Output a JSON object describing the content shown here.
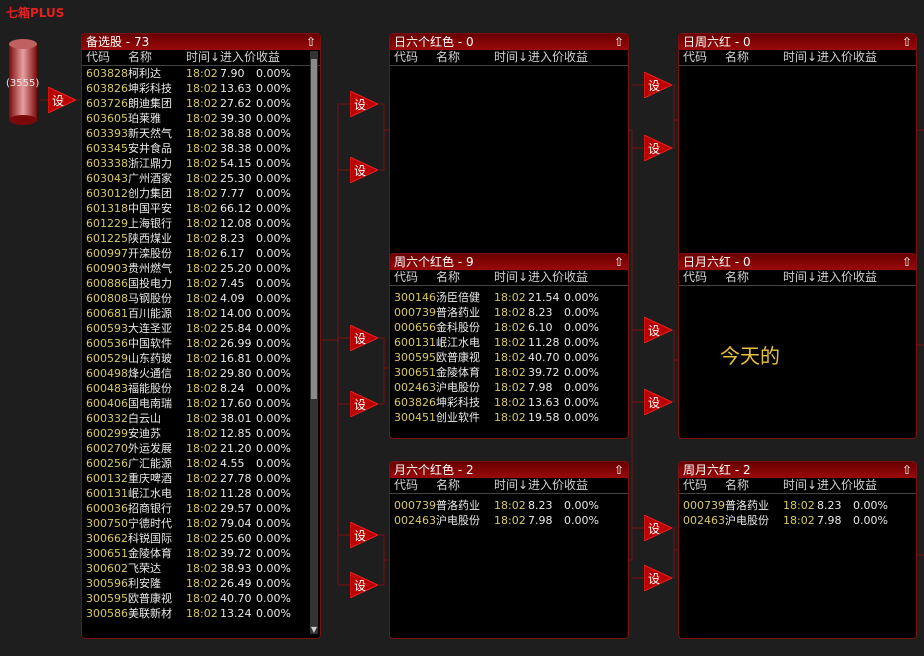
{
  "app_title": "七箱PLUS",
  "source": {
    "count": "(3555)"
  },
  "trigger_label": "设",
  "columns": {
    "code": "代码",
    "name": "名称",
    "time": "时间↓",
    "price": "进入价",
    "pct": "收益"
  },
  "note": "今天的",
  "panels": {
    "main": {
      "title": "备选股 - 73",
      "rows": [
        [
          "603828",
          "柯利达",
          "18:02",
          "7.90",
          "0.00%"
        ],
        [
          "603826",
          "坤彩科技",
          "18:02",
          "13.63",
          "0.00%"
        ],
        [
          "603726",
          "朗迪集团",
          "18:02",
          "27.62",
          "0.00%"
        ],
        [
          "603605",
          "珀莱雅",
          "18:02",
          "39.30",
          "0.00%"
        ],
        [
          "603393",
          "新天然气",
          "18:02",
          "38.88",
          "0.00%"
        ],
        [
          "603345",
          "安井食品",
          "18:02",
          "38.38",
          "0.00%"
        ],
        [
          "603338",
          "浙江鼎力",
          "18:02",
          "54.15",
          "0.00%"
        ],
        [
          "603043",
          "广州酒家",
          "18:02",
          "25.30",
          "0.00%"
        ],
        [
          "603012",
          "创力集团",
          "18:02",
          "7.77",
          "0.00%"
        ],
        [
          "601318",
          "中国平安",
          "18:02",
          "66.12",
          "0.00%"
        ],
        [
          "601229",
          "上海银行",
          "18:02",
          "12.08",
          "0.00%"
        ],
        [
          "601225",
          "陕西煤业",
          "18:02",
          "8.23",
          "0.00%"
        ],
        [
          "600997",
          "开滦股份",
          "18:02",
          "6.17",
          "0.00%"
        ],
        [
          "600903",
          "贵州燃气",
          "18:02",
          "25.20",
          "0.00%"
        ],
        [
          "600886",
          "国投电力",
          "18:02",
          "7.45",
          "0.00%"
        ],
        [
          "600808",
          "马钢股份",
          "18:02",
          "4.09",
          "0.00%"
        ],
        [
          "600681",
          "百川能源",
          "18:02",
          "14.00",
          "0.00%"
        ],
        [
          "600593",
          "大连圣亚",
          "18:02",
          "25.84",
          "0.00%"
        ],
        [
          "600536",
          "中国软件",
          "18:02",
          "26.99",
          "0.00%"
        ],
        [
          "600529",
          "山东药玻",
          "18:02",
          "16.81",
          "0.00%"
        ],
        [
          "600498",
          "烽火通信",
          "18:02",
          "29.80",
          "0.00%"
        ],
        [
          "600483",
          "福能股份",
          "18:02",
          "8.24",
          "0.00%"
        ],
        [
          "600406",
          "国电南瑞",
          "18:02",
          "17.60",
          "0.00%"
        ],
        [
          "600332",
          "白云山",
          "18:02",
          "38.01",
          "0.00%"
        ],
        [
          "600299",
          "安迪苏",
          "18:02",
          "12.85",
          "0.00%"
        ],
        [
          "600270",
          "外运发展",
          "18:02",
          "21.20",
          "0.00%"
        ],
        [
          "600256",
          "广汇能源",
          "18:02",
          "4.55",
          "0.00%"
        ],
        [
          "600132",
          "重庆啤酒",
          "18:02",
          "27.78",
          "0.00%"
        ],
        [
          "600131",
          "岷江水电",
          "18:02",
          "11.28",
          "0.00%"
        ],
        [
          "600036",
          "招商银行",
          "18:02",
          "29.57",
          "0.00%"
        ],
        [
          "300750",
          "宁德时代",
          "18:02",
          "79.04",
          "0.00%"
        ],
        [
          "300662",
          "科锐国际",
          "18:02",
          "25.60",
          "0.00%"
        ],
        [
          "300651",
          "金陵体育",
          "18:02",
          "39.72",
          "0.00%"
        ],
        [
          "300602",
          "飞荣达",
          "18:02",
          "38.93",
          "0.00%"
        ],
        [
          "300596",
          "利安隆",
          "18:02",
          "26.49",
          "0.00%"
        ],
        [
          "300595",
          "欧普康视",
          "18:02",
          "40.70",
          "0.00%"
        ],
        [
          "300586",
          "美联新材",
          "18:02",
          "13.24",
          "0.00%"
        ]
      ]
    },
    "day6": {
      "title": "日六个红色 - 0",
      "rows": []
    },
    "week6": {
      "title": "周六个红色 - 9",
      "rows": [
        [
          "300146",
          "汤臣倍健",
          "18:02",
          "21.54",
          "0.00%"
        ],
        [
          "000739",
          "普洛药业",
          "18:02",
          "8.23",
          "0.00%"
        ],
        [
          "000656",
          "金科股份",
          "18:02",
          "6.10",
          "0.00%"
        ],
        [
          "600131",
          "岷江水电",
          "18:02",
          "11.28",
          "0.00%"
        ],
        [
          "300595",
          "欧普康视",
          "18:02",
          "40.70",
          "0.00%"
        ],
        [
          "300651",
          "金陵体育",
          "18:02",
          "39.72",
          "0.00%"
        ],
        [
          "002463",
          "沪电股份",
          "18:02",
          "7.98",
          "0.00%"
        ],
        [
          "603826",
          "坤彩科技",
          "18:02",
          "13.63",
          "0.00%"
        ],
        [
          "300451",
          "创业软件",
          "18:02",
          "19.58",
          "0.00%"
        ]
      ]
    },
    "month6": {
      "title": "月六个红色 - 2",
      "rows": [
        [
          "000739",
          "普洛药业",
          "18:02",
          "8.23",
          "0.00%"
        ],
        [
          "002463",
          "沪电股份",
          "18:02",
          "7.98",
          "0.00%"
        ]
      ]
    },
    "dayweek": {
      "title": "日周六红 - 0",
      "rows": []
    },
    "daymonth": {
      "title": "日月六红 - 0",
      "rows": []
    },
    "weekmonth": {
      "title": "周月六红 - 2",
      "rows": [
        [
          "000739",
          "普洛药业",
          "18:02",
          "8.23",
          "0.00%"
        ],
        [
          "002463",
          "沪电股份",
          "18:02",
          "7.98",
          "0.00%"
        ]
      ]
    }
  },
  "colors": {
    "accent": "#9a0a0a",
    "code": "#d8c860",
    "line": "#7a1010",
    "note": "#e8c040"
  }
}
